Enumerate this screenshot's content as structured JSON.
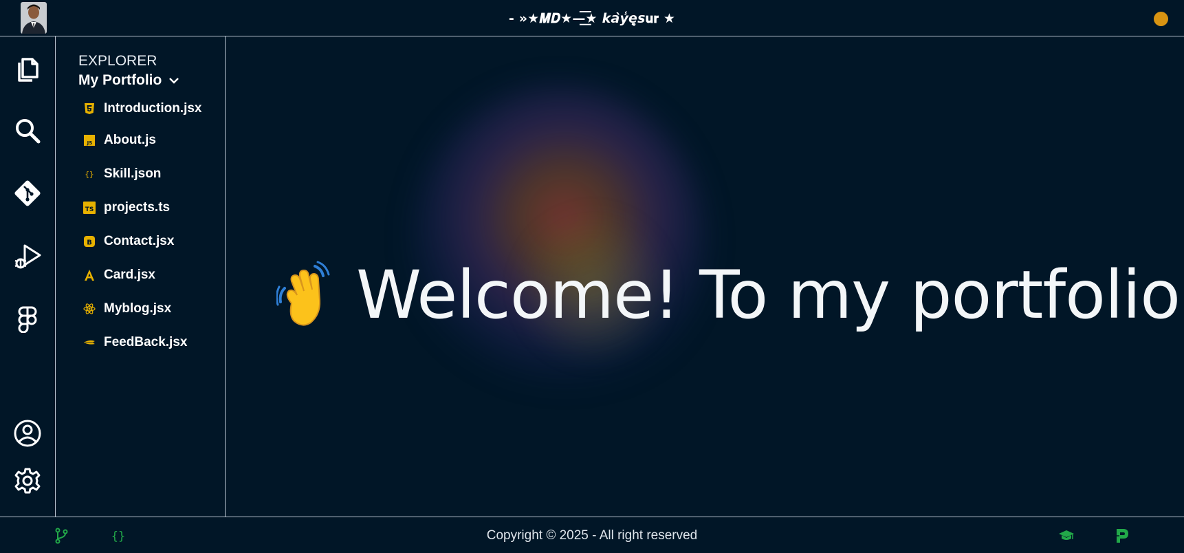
{
  "header": {
    "title": "- »★𝑴𝑫★—͟͞͞★ 𝙠𝙖̀𝙮̾𝙚̨̥𝙨𝐮𝐫 ★",
    "avatar_icon": "profile-photo",
    "status_color": "#d99412"
  },
  "activity_bar": {
    "items": [
      {
        "name": "files-icon"
      },
      {
        "name": "search-icon"
      },
      {
        "name": "git-icon"
      },
      {
        "name": "run-debug-icon"
      },
      {
        "name": "figma-icon"
      },
      {
        "name": "account-icon"
      },
      {
        "name": "settings-icon"
      }
    ]
  },
  "explorer": {
    "title": "EXPLORER",
    "project": "My Portfolio",
    "files": [
      {
        "label": "Introduction.jsx",
        "icon": "html5-icon"
      },
      {
        "label": "About.js",
        "icon": "js-icon"
      },
      {
        "label": "Skill.json",
        "icon": "json-icon"
      },
      {
        "label": "projects.ts",
        "icon": "ts-icon"
      },
      {
        "label": "Contact.jsx",
        "icon": "bootstrap-icon"
      },
      {
        "label": "Card.jsx",
        "icon": "angular-icon"
      },
      {
        "label": "Myblog.jsx",
        "icon": "react-icon"
      },
      {
        "label": "FeedBack.jsx",
        "icon": "feather-icon"
      }
    ]
  },
  "main": {
    "welcome_text": "Welcome! To my portfolio",
    "wave_icon": "waving-hand-icon"
  },
  "footer": {
    "copyright": "Copyright © 2025 - All right reserved",
    "left_icons": [
      "git-branch-icon",
      "braces-icon"
    ],
    "right_icons": [
      "graduation-cap-icon",
      "p-logo-icon"
    ],
    "accent": "#22a849"
  },
  "colors": {
    "background": "#011627",
    "border": "#b7c3cf",
    "file_icon": "#e8b200"
  }
}
